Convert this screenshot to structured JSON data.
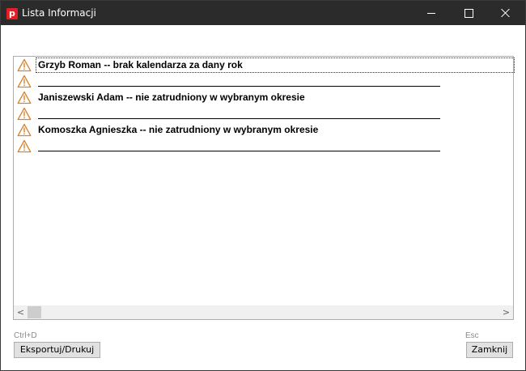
{
  "window": {
    "title": "Lista Informacji",
    "app_icon_letter": "p"
  },
  "list": {
    "items": [
      {
        "type": "warning",
        "text": "Grzyb Roman -- brak kalendarza za dany rok",
        "selected": true
      },
      {
        "type": "warning",
        "text": "",
        "separator": true
      },
      {
        "type": "warning",
        "text": "Janiszewski Adam -- nie zatrudniony w wybranym okresie"
      },
      {
        "type": "warning",
        "text": "",
        "separator": true
      },
      {
        "type": "warning",
        "text": "Komoszka Agnieszka -- nie zatrudniony w wybranym okresie"
      },
      {
        "type": "warning",
        "text": "",
        "separator": true
      }
    ],
    "icon": "warning-triangle-icon",
    "scroll_left": "<",
    "scroll_right": ">"
  },
  "footer": {
    "export_shortcut": "Ctrl+D",
    "export_label": "Eksportuj/Drukuj",
    "close_shortcut": "Esc",
    "close_label": "Zamknij"
  },
  "colors": {
    "titlebar": "#2b2b2b",
    "warning_stroke": "#d9832b",
    "app_icon": "#e41e26"
  }
}
